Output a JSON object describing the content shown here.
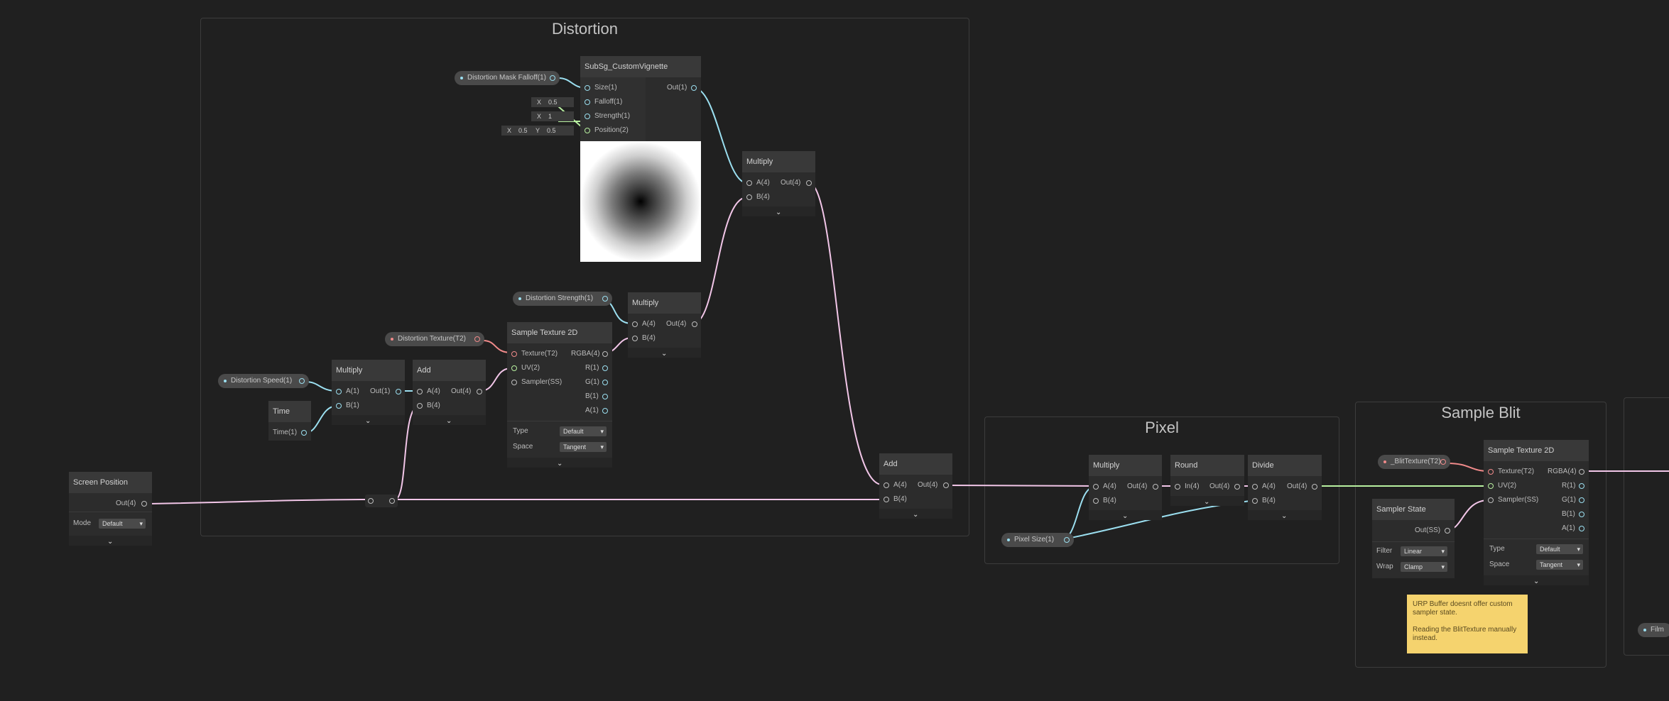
{
  "groups": {
    "distortion": "Distortion",
    "pixel": "Pixel",
    "sample_blit": "Sample Blit"
  },
  "nodes": {
    "vignette": {
      "title": "SubSg_CustomVignette",
      "inputs": [
        "Size(1)",
        "Falloff(1)",
        "Strength(1)",
        "Position(2)"
      ],
      "output": "Out(1)",
      "falloff": {
        "label": "X",
        "value": "0.5"
      },
      "strength": {
        "label": "X",
        "value": "1"
      },
      "position": {
        "x_label": "X",
        "x": "0.5",
        "y_label": "Y",
        "y": "0.5"
      }
    },
    "multiply_top": {
      "title": "Multiply",
      "in_a": "A(4)",
      "in_b": "B(4)",
      "out": "Out(4)"
    },
    "multiply_strength": {
      "title": "Multiply",
      "in_a": "A(4)",
      "in_b": "B(4)",
      "out": "Out(4)"
    },
    "sample_texture": {
      "title": "Sample Texture 2D",
      "inputs": [
        "Texture(T2)",
        "UV(2)",
        "Sampler(SS)"
      ],
      "outputs": [
        "RGBA(4)",
        "R(1)",
        "G(1)",
        "B(1)",
        "A(1)"
      ],
      "type_label": "Type",
      "type_value": "Default",
      "space_label": "Space",
      "space_value": "Tangent"
    },
    "multiply_speed": {
      "title": "Multiply",
      "in_a": "A(1)",
      "in_b": "B(1)",
      "out": "Out(1)"
    },
    "add_small": {
      "title": "Add",
      "in_a": "A(4)",
      "in_b": "B(4)",
      "out": "Out(4)"
    },
    "time": {
      "title": "Time",
      "out": "Time(1)"
    },
    "screen_position": {
      "title": "Screen Position",
      "out": "Out(4)",
      "mode_label": "Mode",
      "mode_value": "Default"
    },
    "add_big": {
      "title": "Add",
      "in_a": "A(4)",
      "in_b": "B(4)",
      "out": "Out(4)"
    },
    "pixel_multiply": {
      "title": "Multiply",
      "in_a": "A(4)",
      "in_b": "B(4)",
      "out": "Out(4)"
    },
    "round": {
      "title": "Round",
      "in": "In(4)",
      "out": "Out(4)"
    },
    "divide": {
      "title": "Divide",
      "in_a": "A(4)",
      "in_b": "B(4)",
      "out": "Out(4)"
    },
    "sampler_state": {
      "title": "Sampler State",
      "out": "Out(SS)",
      "filter_label": "Filter",
      "filter_value": "Linear",
      "wrap_label": "Wrap",
      "wrap_value": "Clamp"
    },
    "blit_sample": {
      "title": "Sample Texture 2D",
      "inputs": [
        "Texture(T2)",
        "UV(2)",
        "Sampler(SS)"
      ],
      "outputs": [
        "RGBA(4)",
        "R(1)",
        "G(1)",
        "B(1)",
        "A(1)"
      ],
      "type_label": "Type",
      "type_value": "Default",
      "space_label": "Space",
      "space_value": "Tangent"
    }
  },
  "properties": {
    "mask_falloff": "Distortion Mask Falloff(1)",
    "strength": "Distortion Strength(1)",
    "texture": "Distortion Texture(T2)",
    "speed": "Distortion Speed(1)",
    "pixel_size": "Pixel Size(1)",
    "blit_texture": "_BlitTexture(T2)",
    "film": "Film"
  },
  "sticky_note": "URP Buffer doesnt offer custom sampler state.\n\nReading the BlitTexture manually instead.",
  "colors": {
    "float_wire": "#9bdff0",
    "vector2_wire": "#b8f0a0",
    "vector4_wire": "#f2c6e8",
    "texture_port": "#f08a8a",
    "note": "#f5d36e"
  }
}
